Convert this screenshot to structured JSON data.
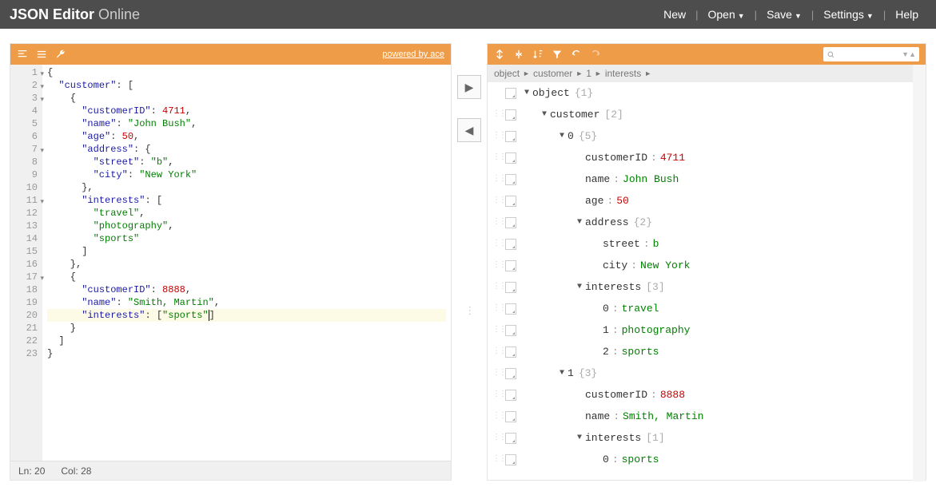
{
  "header": {
    "logo_bold": "JSON Editor",
    "logo_light": " Online",
    "menu": [
      "New",
      "Open",
      "Save",
      "Settings",
      "Help"
    ],
    "menu_dropdown": [
      false,
      true,
      true,
      true,
      false
    ]
  },
  "left": {
    "powered": "powered by ace",
    "status_ln_label": "Ln:",
    "status_ln": "20",
    "status_col_label": "Col:",
    "status_col": "28",
    "lines": [
      {
        "n": 1,
        "fold": true,
        "tokens": [
          {
            "t": "p",
            "v": "{"
          }
        ]
      },
      {
        "n": 2,
        "fold": true,
        "tokens": [
          {
            "t": "p",
            "v": "  "
          },
          {
            "t": "k",
            "v": "\"customer\""
          },
          {
            "t": "p",
            "v": ": ["
          }
        ]
      },
      {
        "n": 3,
        "fold": true,
        "tokens": [
          {
            "t": "p",
            "v": "    {"
          }
        ]
      },
      {
        "n": 4,
        "tokens": [
          {
            "t": "p",
            "v": "      "
          },
          {
            "t": "k",
            "v": "\"customerID\""
          },
          {
            "t": "p",
            "v": ": "
          },
          {
            "t": "n",
            "v": "4711"
          },
          {
            "t": "p",
            "v": ","
          }
        ]
      },
      {
        "n": 5,
        "tokens": [
          {
            "t": "p",
            "v": "      "
          },
          {
            "t": "k",
            "v": "\"name\""
          },
          {
            "t": "p",
            "v": ": "
          },
          {
            "t": "s",
            "v": "\"John Bush\""
          },
          {
            "t": "p",
            "v": ","
          }
        ]
      },
      {
        "n": 6,
        "tokens": [
          {
            "t": "p",
            "v": "      "
          },
          {
            "t": "k",
            "v": "\"age\""
          },
          {
            "t": "p",
            "v": ": "
          },
          {
            "t": "n",
            "v": "50"
          },
          {
            "t": "p",
            "v": ","
          }
        ]
      },
      {
        "n": 7,
        "fold": true,
        "tokens": [
          {
            "t": "p",
            "v": "      "
          },
          {
            "t": "k",
            "v": "\"address\""
          },
          {
            "t": "p",
            "v": ": {"
          }
        ]
      },
      {
        "n": 8,
        "tokens": [
          {
            "t": "p",
            "v": "        "
          },
          {
            "t": "k",
            "v": "\"street\""
          },
          {
            "t": "p",
            "v": ": "
          },
          {
            "t": "s",
            "v": "\"b\""
          },
          {
            "t": "p",
            "v": ","
          }
        ]
      },
      {
        "n": 9,
        "tokens": [
          {
            "t": "p",
            "v": "        "
          },
          {
            "t": "k",
            "v": "\"city\""
          },
          {
            "t": "p",
            "v": ": "
          },
          {
            "t": "s",
            "v": "\"New York\""
          }
        ]
      },
      {
        "n": 10,
        "tokens": [
          {
            "t": "p",
            "v": "      },"
          }
        ]
      },
      {
        "n": 11,
        "fold": true,
        "tokens": [
          {
            "t": "p",
            "v": "      "
          },
          {
            "t": "k",
            "v": "\"interests\""
          },
          {
            "t": "p",
            "v": ": ["
          }
        ]
      },
      {
        "n": 12,
        "tokens": [
          {
            "t": "p",
            "v": "        "
          },
          {
            "t": "s",
            "v": "\"travel\""
          },
          {
            "t": "p",
            "v": ","
          }
        ]
      },
      {
        "n": 13,
        "tokens": [
          {
            "t": "p",
            "v": "        "
          },
          {
            "t": "s",
            "v": "\"photography\""
          },
          {
            "t": "p",
            "v": ","
          }
        ]
      },
      {
        "n": 14,
        "tokens": [
          {
            "t": "p",
            "v": "        "
          },
          {
            "t": "s",
            "v": "\"sports\""
          }
        ]
      },
      {
        "n": 15,
        "tokens": [
          {
            "t": "p",
            "v": "      ]"
          }
        ]
      },
      {
        "n": 16,
        "tokens": [
          {
            "t": "p",
            "v": "    },"
          }
        ]
      },
      {
        "n": 17,
        "fold": true,
        "tokens": [
          {
            "t": "p",
            "v": "    {"
          }
        ]
      },
      {
        "n": 18,
        "tokens": [
          {
            "t": "p",
            "v": "      "
          },
          {
            "t": "k",
            "v": "\"customerID\""
          },
          {
            "t": "p",
            "v": ": "
          },
          {
            "t": "n",
            "v": "8888"
          },
          {
            "t": "p",
            "v": ","
          }
        ]
      },
      {
        "n": 19,
        "tokens": [
          {
            "t": "p",
            "v": "      "
          },
          {
            "t": "k",
            "v": "\"name\""
          },
          {
            "t": "p",
            "v": ": "
          },
          {
            "t": "s",
            "v": "\"Smith, Martin\""
          },
          {
            "t": "p",
            "v": ","
          }
        ]
      },
      {
        "n": 20,
        "hl": true,
        "tokens": [
          {
            "t": "p",
            "v": "      "
          },
          {
            "t": "k",
            "v": "\"interests\""
          },
          {
            "t": "p",
            "v": ": ["
          },
          {
            "t": "s",
            "v": "\"sports\""
          },
          {
            "t": "cursor",
            "v": ""
          },
          {
            "t": "p",
            "v": "]"
          }
        ]
      },
      {
        "n": 21,
        "tokens": [
          {
            "t": "p",
            "v": "    }"
          }
        ]
      },
      {
        "n": 22,
        "tokens": [
          {
            "t": "p",
            "v": "  ]"
          }
        ]
      },
      {
        "n": 23,
        "tokens": [
          {
            "t": "p",
            "v": "}"
          }
        ]
      }
    ]
  },
  "right": {
    "breadcrumb": [
      "object",
      "customer",
      "1",
      "interests"
    ],
    "tree": [
      {
        "depth": 0,
        "exp": "▼",
        "key": "object",
        "meta": "{1}"
      },
      {
        "depth": 1,
        "exp": "▼",
        "key": "customer",
        "meta": "[2]"
      },
      {
        "depth": 2,
        "exp": "▼",
        "key": "0",
        "meta": "{5}"
      },
      {
        "depth": 3,
        "key": "customerID",
        "vtype": "n",
        "val": "4711"
      },
      {
        "depth": 3,
        "key": "name",
        "vtype": "s",
        "val": "John Bush"
      },
      {
        "depth": 3,
        "key": "age",
        "vtype": "n",
        "val": "50"
      },
      {
        "depth": 3,
        "exp": "▼",
        "key": "address",
        "meta": "{2}"
      },
      {
        "depth": 4,
        "key": "street",
        "vtype": "s",
        "val": "b"
      },
      {
        "depth": 4,
        "key": "city",
        "vtype": "s",
        "val": "New York"
      },
      {
        "depth": 3,
        "exp": "▼",
        "key": "interests",
        "meta": "[3]"
      },
      {
        "depth": 4,
        "key": "0",
        "vtype": "s",
        "val": "travel"
      },
      {
        "depth": 4,
        "key": "1",
        "vtype": "s",
        "val": "photography"
      },
      {
        "depth": 4,
        "key": "2",
        "vtype": "s",
        "val": "sports"
      },
      {
        "depth": 2,
        "exp": "▼",
        "key": "1",
        "meta": "{3}"
      },
      {
        "depth": 3,
        "key": "customerID",
        "vtype": "n",
        "val": "8888"
      },
      {
        "depth": 3,
        "key": "name",
        "vtype": "s",
        "val": "Smith, Martin"
      },
      {
        "depth": 3,
        "exp": "▼",
        "key": "interests",
        "meta": "[1]"
      },
      {
        "depth": 4,
        "key": "0",
        "vtype": "s",
        "val": "sports"
      }
    ]
  }
}
